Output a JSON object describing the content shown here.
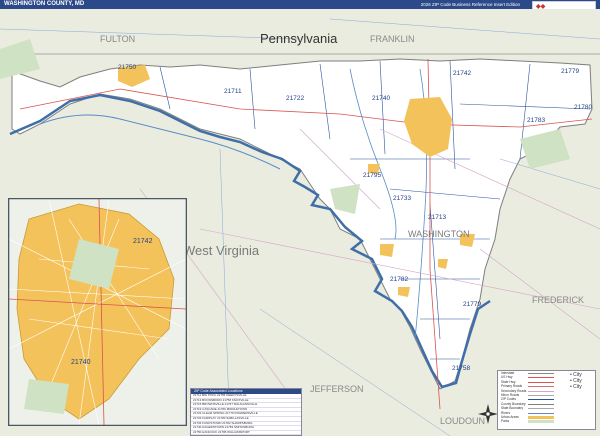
{
  "map": {
    "title": "WASHINGTON COUNTY, MD",
    "subtitle": "2026 ZIP Code Business Reference Insert Edition"
  },
  "regions": {
    "fulton": "FULTON",
    "pennsylvania": "Pennsylvania",
    "franklin": "FRANKLIN",
    "west_virginia": "West Virginia",
    "washington": "WASHINGTON",
    "frederick": "FREDERICK",
    "jefferson": "JEFFERSON",
    "loudoun": "LOUDOUN"
  },
  "zips": [
    "21750",
    "21711",
    "21722",
    "21740",
    "21742",
    "21779",
    "21780",
    "21783",
    "21795",
    "21733",
    "21713",
    "21782",
    "21779",
    "21758"
  ],
  "inset": {
    "zips": [
      "21742",
      "21740"
    ]
  },
  "legend": {
    "header": "ZIP Code Associated Locations",
    "rows": [
      "21711 BIG POOL    21756 KEEDYSVILLE",
      "21713 BOONSBORO   21758 KNOXVILLE",
      "21715 BROWNSVILLE 21767 MAUGANSVILLE",
      "21719 CASCADE     21769 MIDDLETOWN",
      "21722 CLEAR SPRING 21779 ROHRERSVILLE",
      "21733 FAIRPLAY    21780 SABILLASVILLE",
      "21734 FUNKSTOWN   21782 SHARPSBURG",
      "21740 HAGERSTOWN  21783 SMITHSBURG",
      "21750 HANCOCK     21795 WILLIAMSPORT"
    ]
  },
  "key": [
    "Interstate",
    "US Hwy",
    "State Hwy",
    "Primary Roads",
    "Secondary Roads",
    "Minor Roads",
    "ZIP Codes",
    "County Boundary",
    "State Boundary",
    "Rivers",
    "Urban Areas",
    "Parks"
  ],
  "citykey": [
    "• City",
    "• City",
    "• City"
  ]
}
